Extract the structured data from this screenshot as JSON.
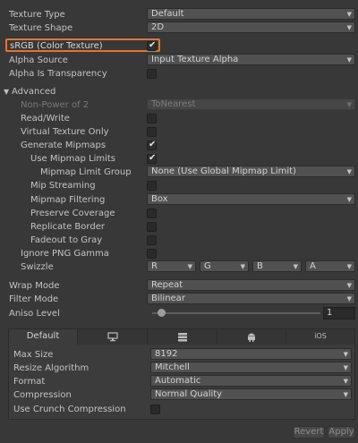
{
  "fields": {
    "texture_type": {
      "label": "Texture Type",
      "value": "Default"
    },
    "texture_shape": {
      "label": "Texture Shape",
      "value": "2D"
    },
    "srgb": {
      "label": "sRGB (Color Texture)",
      "checked": true
    },
    "alpha_source": {
      "label": "Alpha Source",
      "value": "Input Texture Alpha"
    },
    "alpha_transparency": {
      "label": "Alpha Is Transparency",
      "checked": false
    }
  },
  "advanced": {
    "header": "Advanced",
    "non_power_of_2": {
      "label": "Non-Power of 2",
      "value": "ToNearest"
    },
    "read_write": {
      "label": "Read/Write",
      "checked": false
    },
    "virtual_texture_only": {
      "label": "Virtual Texture Only",
      "checked": false
    },
    "generate_mipmaps": {
      "label": "Generate Mipmaps",
      "checked": true
    },
    "use_mipmap_limits": {
      "label": "Use Mipmap Limits",
      "checked": true
    },
    "mipmap_limit_group": {
      "label": "Mipmap Limit Group",
      "value": "None (Use Global Mipmap Limit)"
    },
    "mip_streaming": {
      "label": "Mip Streaming",
      "checked": false
    },
    "mipmap_filtering": {
      "label": "Mipmap Filtering",
      "value": "Box"
    },
    "preserve_coverage": {
      "label": "Preserve Coverage",
      "checked": false
    },
    "replicate_border": {
      "label": "Replicate Border",
      "checked": false
    },
    "fadeout_to_gray": {
      "label": "Fadeout to Gray",
      "checked": false
    },
    "ignore_png_gamma": {
      "label": "Ignore PNG Gamma",
      "checked": false
    },
    "swizzle": {
      "label": "Swizzle",
      "r": "R",
      "g": "G",
      "b": "B",
      "a": "A"
    }
  },
  "wrap_mode": {
    "label": "Wrap Mode",
    "value": "Repeat"
  },
  "filter_mode": {
    "label": "Filter Mode",
    "value": "Bilinear"
  },
  "aniso_level": {
    "label": "Aniso Level",
    "value": "1",
    "slider_fraction": 0.0
  },
  "platform": {
    "tabs": [
      {
        "label": "Default",
        "active": true
      },
      {
        "icon": "monitor-icon"
      },
      {
        "icon": "server-icon"
      },
      {
        "icon": "android-icon"
      },
      {
        "label": "iOS"
      }
    ],
    "max_size": {
      "label": "Max Size",
      "value": "8192"
    },
    "resize_algorithm": {
      "label": "Resize Algorithm",
      "value": "Mitchell"
    },
    "format": {
      "label": "Format",
      "value": "Automatic"
    },
    "compression": {
      "label": "Compression",
      "value": "Normal Quality"
    },
    "crunch": {
      "label": "Use Crunch Compression",
      "checked": false
    }
  },
  "buttons": {
    "revert": "Revert",
    "apply": "Apply"
  },
  "colors": {
    "highlight": "#e8732b",
    "background": "#383838"
  }
}
